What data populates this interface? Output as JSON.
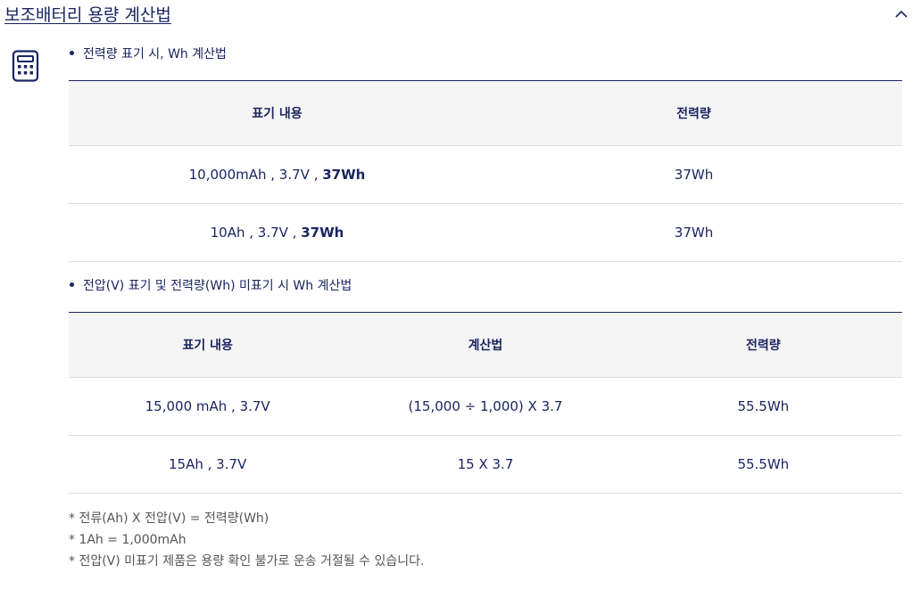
{
  "header": {
    "title": "보조배터리 용량 계산법",
    "toggle_icon": "chevron-up-icon"
  },
  "icons": {
    "calculator": "calculator-icon"
  },
  "colors": {
    "text": "#1a2560",
    "header_bg": "#f5f5f5",
    "row_border": "#dddddd",
    "note_text": "#555555"
  },
  "section1": {
    "bullet": "전력량 표기 시, Wh 계산법",
    "columns": [
      "표기 내용",
      "전력량"
    ],
    "rows": [
      {
        "label_plain": "10,000mAh , 3.7V , ",
        "label_bold": "37Wh",
        "energy": "37Wh"
      },
      {
        "label_plain": "10Ah , 3.7V , ",
        "label_bold": "37Wh",
        "energy": "37Wh"
      }
    ]
  },
  "section2": {
    "bullet": "전압(V) 표기 및 전력량(Wh) 미표기 시 Wh 계산법",
    "columns": [
      "표기 내용",
      "계산법",
      "전력량"
    ],
    "rows": [
      {
        "label": "15,000 mAh , 3.7V",
        "formula": "(15,000 ÷ 1,000) X 3.7",
        "energy": "55.5Wh"
      },
      {
        "label": "15Ah , 3.7V",
        "formula": "15 X 3.7",
        "energy": "55.5Wh"
      }
    ]
  },
  "notes": [
    "* 전류(Ah) X 전압(V) = 전력량(Wh)",
    "* 1Ah = 1,000mAh",
    "* 전압(V) 미표기 제품은 용량 확인 불가로 운송 거절될 수 있습니다."
  ]
}
